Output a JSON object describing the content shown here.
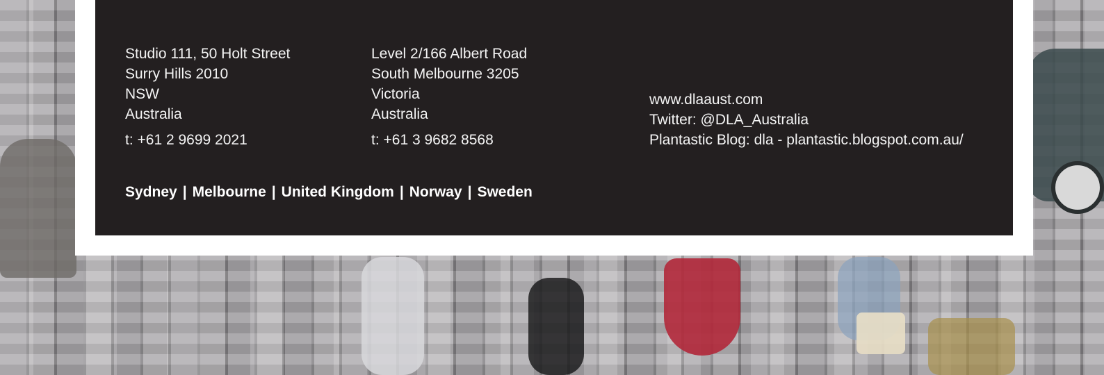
{
  "footer": {
    "sydney": {
      "lines": [
        "Studio 111, 50 Holt Street",
        "Surry Hills 2010",
        "NSW",
        "Australia"
      ],
      "phone": "t: +61 2 9699 2021"
    },
    "melbourne": {
      "lines": [
        "Level 2/166 Albert Road",
        "South Melbourne 3205",
        "Victoria",
        "Australia"
      ],
      "phone": "t: +61 3 9682 8568"
    },
    "contact": {
      "website": "www.dlaaust.com",
      "twitter": "Twitter: @DLA_Australia",
      "blog": "Plantastic Blog: dla - plantastic.blogspot.com.au/"
    },
    "offices": {
      "items": [
        "Sydney",
        "Melbourne",
        "United Kingdom",
        "Norway",
        "Sweden"
      ],
      "separator": "|"
    }
  },
  "colors": {
    "panel_bg": "#231f20",
    "frame_bg": "#ffffff",
    "text": "#f4f4f4"
  }
}
